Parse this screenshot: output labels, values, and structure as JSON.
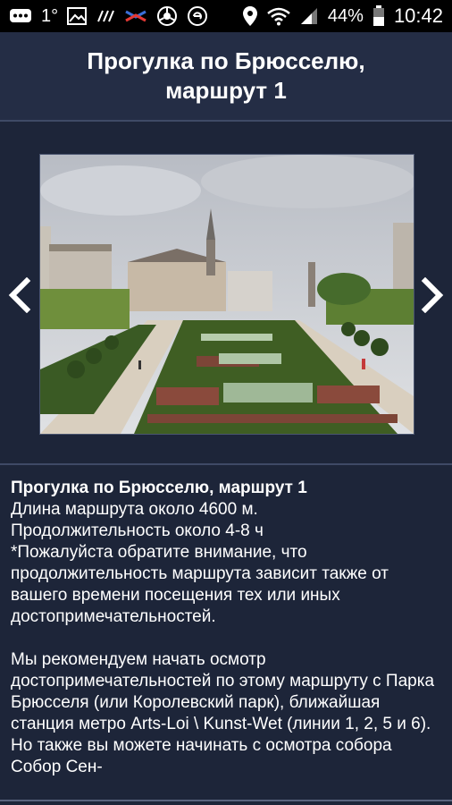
{
  "status_bar": {
    "temperature": "1°",
    "battery_percent": "44%",
    "time": "10:42"
  },
  "header": {
    "title": "Прогулка по Брюсселю, маршрут 1"
  },
  "gallery": {
    "prev_icon": "chevron-left-icon",
    "next_icon": "chevron-right-icon"
  },
  "description": {
    "heading": "Прогулка по Брюсселю, маршрут 1",
    "length": "Длина маршрута около 4600 м.",
    "duration": "Продолжительность около 4-8 ч",
    "note": "*Пожалуйста обратите внимание, что продолжительность маршрута зависит также от вашего времени посещения тех или иных достопримечательностей.",
    "paragraph": "Мы рекомендуем начать осмотр достопримечательностей по этому маршруту с Парка Брюсселя (или Королевский парк), ближайшая станция метро Arts-Loi \\ Kunst-Wet (линии 1, 2, 5 и 6). Но также вы можете начинать с осмотра собора Собор Сен-"
  },
  "colors": {
    "background": "#1d2539",
    "header": "#242d45",
    "statusbar": "#000000",
    "text": "#ffffff"
  }
}
